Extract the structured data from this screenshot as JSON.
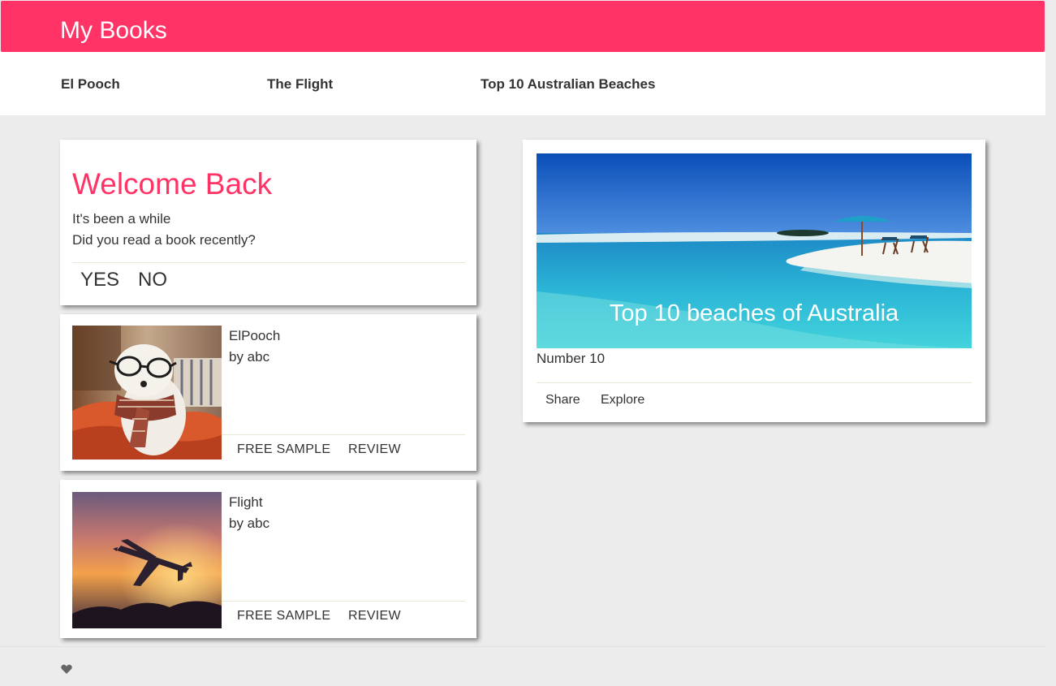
{
  "app": {
    "title": "My Books",
    "accent": "#ff3366"
  },
  "nav": {
    "items": [
      {
        "label": "El Pooch"
      },
      {
        "label": "The Flight"
      },
      {
        "label": "Top 10 Australian Beaches"
      }
    ]
  },
  "welcome": {
    "title": "Welcome Back",
    "line1": "It's been a while",
    "line2": "Did you read a book recently?",
    "yes_label": "YES",
    "no_label": "NO"
  },
  "books": [
    {
      "title": "ElPooch",
      "author": "by abc",
      "sample_label": "FREE SAMPLE",
      "review_label": "REVIEW"
    },
    {
      "title": "Flight",
      "author": "by abc",
      "sample_label": "FREE SAMPLE",
      "review_label": "REVIEW"
    }
  ],
  "feature": {
    "caption": "Top 10 beaches of Australia",
    "subtitle": "Number 10",
    "share_label": "Share",
    "explore_label": "Explore"
  },
  "footer": {
    "icon": "heart-icon"
  }
}
